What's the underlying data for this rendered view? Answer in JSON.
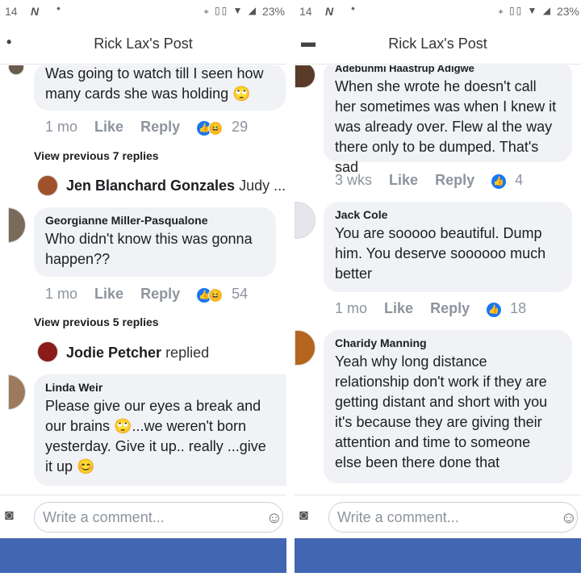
{
  "colors": {
    "brand_bar": "#4267b2",
    "like_blue": "#1877f2",
    "bubble_bg": "#f0f2f5",
    "meta_gray": "#8d949e"
  },
  "left": {
    "status": {
      "time": "14",
      "notif": "N",
      "dot": "•",
      "sys": "⁎ ▯▯ ▼ ◢",
      "battery": "23%"
    },
    "header": {
      "back": "•",
      "title": "Rick Lax's Post"
    },
    "c1": {
      "text": "Was going to watch till I seen how many cards she was holding 🙄",
      "time": "1 mo",
      "like": "Like",
      "reply": "Reply",
      "count": "29"
    },
    "viewprev1": "View previous 7 replies",
    "reply1": {
      "name": "Jen Blanchard Gonzales",
      "snippet": "Judy ..."
    },
    "c2": {
      "name": "Georgianne Miller-Pasqualone",
      "text": "Who didn't know this was gonna happen??",
      "time": "1 mo",
      "like": "Like",
      "reply": "Reply",
      "count": "54"
    },
    "viewprev2": "View previous 5 replies",
    "reply2": {
      "name": "Jodie Petcher",
      "snippet": "replied"
    },
    "c3": {
      "name": "Linda Weir",
      "text": " Please give our eyes a break and our brains 🙄...we weren't born yesterday.  Give it up.. really ...give it up 😊"
    },
    "composer": {
      "placeholder": "Write a comment..."
    }
  },
  "right": {
    "status": {
      "time": "14",
      "notif": "N",
      "dot": "•",
      "sys": "⁎ ▯▯ ▼ ◢",
      "battery": "23%"
    },
    "header": {
      "back": "▬",
      "title": "Rick Lax's Post"
    },
    "c1": {
      "name": "Adebunmi Haastrup Adigwe",
      "text": "When she wrote he doesn't call her sometimes was when I knew it was already over. Flew al the way there only to be dumped. That's sad",
      "time": "3 wks",
      "like": "Like",
      "reply": "Reply",
      "count": "4"
    },
    "c2": {
      "name": "Jack Cole",
      "text": "You are sooooo beautiful. Dump him. You deserve soooooo much better",
      "time": "1 mo",
      "like": "Like",
      "reply": "Reply",
      "count": "18"
    },
    "c3": {
      "name": "Charidy Manning",
      "text": "Yeah why long distance relationship don't work if they are getting distant and short with you it's because they are giving their attention and time to someone else been there done that"
    },
    "composer": {
      "placeholder": "Write a comment..."
    }
  }
}
